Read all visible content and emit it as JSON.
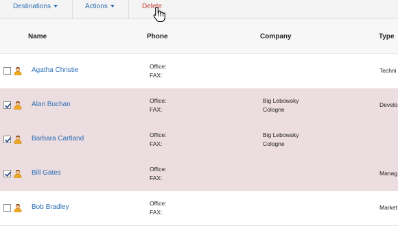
{
  "toolbar": {
    "destinations_label": "Destinations",
    "actions_label": "Actions",
    "delete_label": "Delete"
  },
  "table": {
    "columns": {
      "name": "Name",
      "phone": "Phone",
      "company": "Company",
      "type": "Type"
    },
    "rows": [
      {
        "name": "Agatha Christie",
        "checked": false,
        "office_label": "Office:",
        "fax_label": "FAX:",
        "company_line1": "",
        "company_line2": "",
        "type": "Techni"
      },
      {
        "name": "Alan Buchan",
        "checked": true,
        "office_label": "Office:",
        "fax_label": "FAX:",
        "company_line1": "Big Lebowsky",
        "company_line2": "Cologne",
        "type": "Develo"
      },
      {
        "name": "Barbara Cartland",
        "checked": true,
        "office_label": "Office:",
        "fax_label": "FAX:",
        "company_line1": "Big Lebowsky",
        "company_line2": "Cologne",
        "type": ""
      },
      {
        "name": "Bill Gates",
        "checked": true,
        "office_label": "Office:",
        "fax_label": "FAX:",
        "company_line1": "",
        "company_line2": "",
        "type": "Manag"
      },
      {
        "name": "Bob Bradley",
        "checked": false,
        "office_label": "Office:",
        "fax_label": "FAX:",
        "company_line1": "",
        "company_line2": "",
        "type": "Market"
      }
    ]
  },
  "colors": {
    "link": "#2d6fb4",
    "delete": "#c0392b",
    "selected_row": "#ecdde0",
    "toolbar_bg": "#f4f4f4",
    "header_bg": "#f7f7f7"
  },
  "icons": {
    "contact": "person-icon",
    "checkbox_checked": "checkmark-icon",
    "cursor": "hand-pointer-icon",
    "dropdown": "caret-down-icon"
  }
}
